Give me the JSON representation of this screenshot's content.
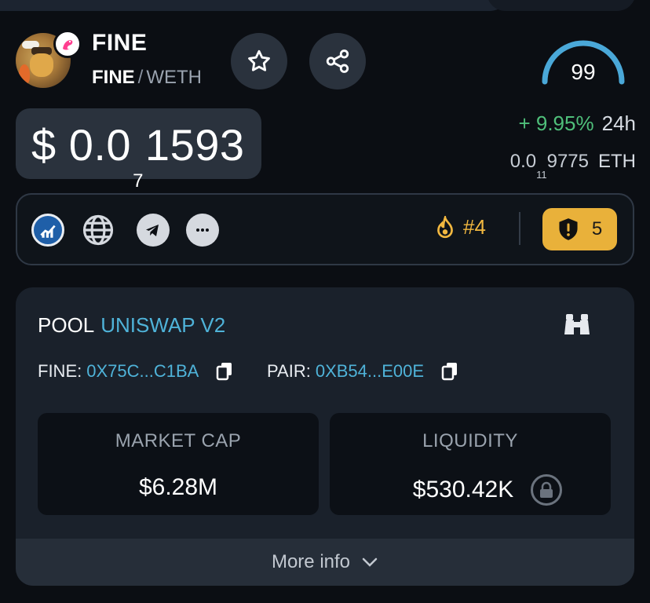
{
  "token": {
    "name": "FINE",
    "pair_base": "FINE",
    "pair_sep": "/",
    "pair_quote": "WETH"
  },
  "score": {
    "value": "99"
  },
  "price": {
    "prefix": "$ 0.0",
    "zeros_sub": "7",
    "digits": "1593",
    "change_pct": "+ 9.95%",
    "change_period": "24h",
    "eth_prefix": "0.0",
    "eth_zeros_sub": "11",
    "eth_digits": "9775",
    "eth_unit": "ETH"
  },
  "links": {
    "trending_rank": "#4",
    "audit_count": "5"
  },
  "pool": {
    "label": "POOL",
    "dex": "UNISWAP V2",
    "fine_key": "FINE:",
    "fine_addr": "0X75C...C1BA",
    "pair_key": "PAIR:",
    "pair_addr": "0XB54...E00E"
  },
  "stats": {
    "market_cap_label": "MARKET CAP",
    "market_cap_value": "$6.28M",
    "liquidity_label": "LIQUIDITY",
    "liquidity_value": "$530.42K"
  },
  "more_info": {
    "label": "More info"
  },
  "colors": {
    "background": "#0b0e13",
    "card": "#1a212b",
    "positive": "#4fbf7a",
    "link": "#4fb3d9",
    "warning": "#e9b13a",
    "gauge": "#4aa8d8"
  },
  "icons": [
    "star-icon",
    "share-icon",
    "chart-logo-icon",
    "globe-icon",
    "telegram-icon",
    "more-icon",
    "fire-icon",
    "shield-alert-icon",
    "binoculars-icon",
    "copy-icon",
    "lock-icon",
    "chevron-down-icon"
  ]
}
